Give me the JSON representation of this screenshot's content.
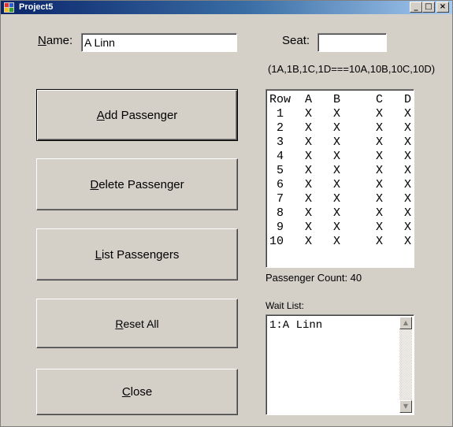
{
  "window": {
    "title": "Project5",
    "minimize_glyph": "_",
    "maximize_glyph": "□",
    "close_glyph": "×"
  },
  "form": {
    "name_label_first": "N",
    "name_label_rest": "ame:",
    "name_value": "A Linn",
    "seat_label": "Seat:",
    "seat_value": "",
    "seat_hint": "(1A,1B,1C,1D===10A,10B,10C,10D)"
  },
  "buttons": {
    "add": {
      "mnemonic": "A",
      "rest": "dd Passenger"
    },
    "delete": {
      "mnemonic": "D",
      "rest": "elete Passenger"
    },
    "list": {
      "mnemonic": "L",
      "rest": "ist Passengers"
    },
    "reset": {
      "mnemonic": "R",
      "rest": "eset All"
    },
    "close": {
      "mnemonic": "C",
      "rest": "lose"
    }
  },
  "seat_chart": {
    "header": "Row  A   B     C   D",
    "rows": [
      " 1   X   X     X   X",
      " 2   X   X     X   X",
      " 3   X   X     X   X",
      " 4   X   X     X   X",
      " 5   X   X     X   X",
      " 6   X   X     X   X",
      " 7   X   X     X   X",
      " 8   X   X     X   X",
      " 9   X   X     X   X",
      "10   X   X     X   X"
    ]
  },
  "passenger_count": "Passenger Count: 40",
  "wait_list": {
    "label": "Wait List:",
    "items": [
      "1:A Linn"
    ],
    "scroll_up_glyph": "▲",
    "scroll_down_glyph": "▼"
  }
}
